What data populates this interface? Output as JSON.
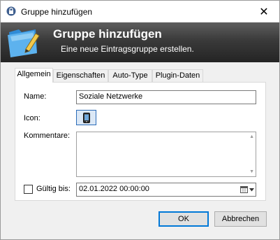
{
  "window": {
    "title": "Gruppe hinzufügen",
    "close_glyph": "✕"
  },
  "banner": {
    "title": "Gruppe hinzufügen",
    "subtitle": "Eine neue Eintragsgruppe erstellen.",
    "icon": "folder-pencil-icon"
  },
  "tabs": [
    {
      "label": "Allgemein",
      "active": true
    },
    {
      "label": "Eigenschaften",
      "active": false
    },
    {
      "label": "Auto-Type",
      "active": false
    },
    {
      "label": "Plugin-Daten",
      "active": false
    }
  ],
  "form": {
    "name_label": "Name:",
    "name_value": "Soziale Netzwerke",
    "icon_label": "Icon:",
    "icon_name": "smartphone-icon",
    "comments_label": "Kommentare:",
    "comments_value": "",
    "expires_label": "Gültig bis:",
    "expires_checked": false,
    "expires_value": "02.01.2022 00:00:00"
  },
  "buttons": {
    "ok": "OK",
    "cancel": "Abbrechen"
  }
}
